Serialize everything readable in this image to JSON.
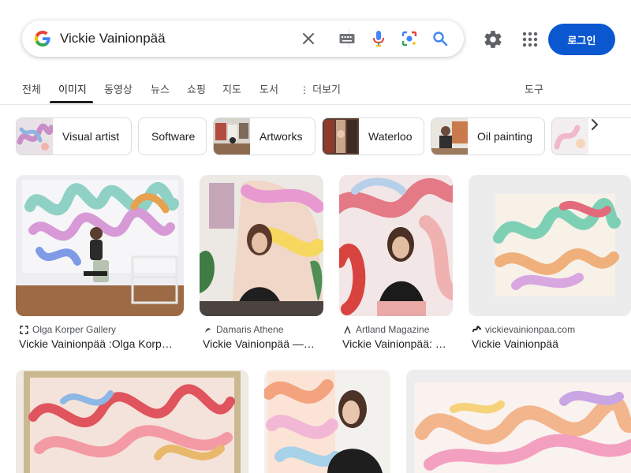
{
  "search": {
    "query": "Vickie Vainionpää"
  },
  "header": {
    "login_label": "로그인"
  },
  "tabs": [
    {
      "label": "전체"
    },
    {
      "label": "이미지"
    },
    {
      "label": "동영상"
    },
    {
      "label": "뉴스"
    },
    {
      "label": "쇼핑"
    },
    {
      "label": "지도"
    },
    {
      "label": "도서"
    },
    {
      "label": "더보기"
    },
    {
      "label": "도구"
    }
  ],
  "active_tab": "이미지",
  "chips": [
    {
      "label": "Visual artist"
    },
    {
      "label": "Software"
    },
    {
      "label": "Artworks"
    },
    {
      "label": "Waterloo"
    },
    {
      "label": "Oil painting"
    }
  ],
  "results": [
    {
      "source": "Olga Korper Gallery",
      "title": "Vickie Vainionpää :Olga Korp…",
      "source_icon": "gallery-icon"
    },
    {
      "source": "Damaris Athene",
      "title": "Vickie Vainionpää —…",
      "source_icon": "damaris-icon"
    },
    {
      "source": "Artland Magazine",
      "title": "Vickie Vainionpää: …",
      "source_icon": "artland-icon"
    },
    {
      "source": "vickievainionpaa.com",
      "title": "Vickie Vainionpää",
      "source_icon": "site-icon"
    }
  ],
  "colors": {
    "accent": "#0b57d0",
    "text": "#202124",
    "muted": "#4d5156",
    "border": "#dadce0"
  }
}
